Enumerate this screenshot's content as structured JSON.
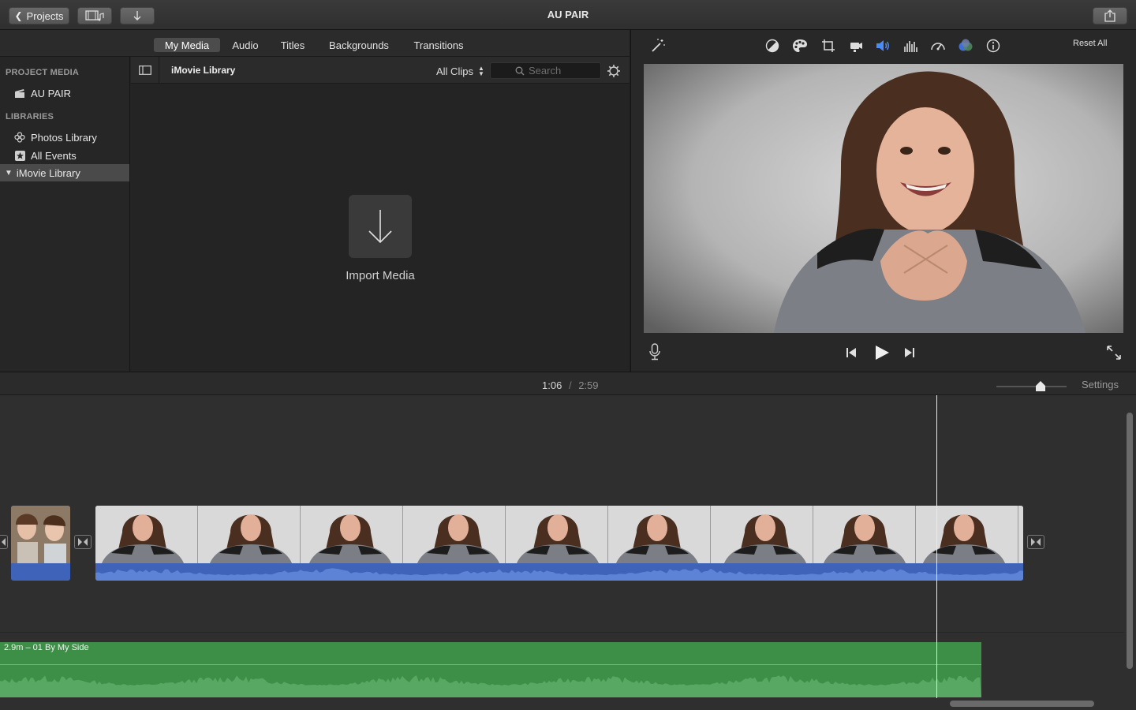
{
  "toolbar": {
    "projects_label": "Projects",
    "window_title": "AU PAIR"
  },
  "media_tabs": [
    {
      "label": "My Media",
      "active": true
    },
    {
      "label": "Audio",
      "active": false
    },
    {
      "label": "Titles",
      "active": false
    },
    {
      "label": "Backgrounds",
      "active": false
    },
    {
      "label": "Transitions",
      "active": false
    }
  ],
  "sidebar": {
    "project_media_heading": "PROJECT MEDIA",
    "project_item": "AU PAIR",
    "libraries_heading": "LIBRARIES",
    "items": [
      {
        "label": "Photos Library",
        "icon": "photos-icon"
      },
      {
        "label": "All Events",
        "icon": "star-icon"
      },
      {
        "label": "iMovie Library",
        "icon": "disclosure-triangle-icon",
        "selected": true
      }
    ]
  },
  "library_bar": {
    "title": "iMovie Library",
    "filter": "All Clips",
    "search_placeholder": "Search"
  },
  "import": {
    "label": "Import Media"
  },
  "viewer": {
    "reset_all_label": "Reset All",
    "adjust_icons": [
      "color-balance-icon",
      "color-correction-icon",
      "crop-icon",
      "stabilization-icon",
      "volume-icon",
      "equalizer-icon",
      "speed-icon",
      "clip-filter-icon",
      "info-icon"
    ]
  },
  "timeline": {
    "current_time": "1:06",
    "separator": "/",
    "total_time": "2:59",
    "settings_label": "Settings",
    "zoom": 0.72,
    "music_clip_label": "2.9m – 01 By My Side"
  },
  "colors": {
    "accent_blue": "#4a8cf7",
    "audio_blue": "#4a6fc4",
    "music_green": "#3d8e47"
  }
}
